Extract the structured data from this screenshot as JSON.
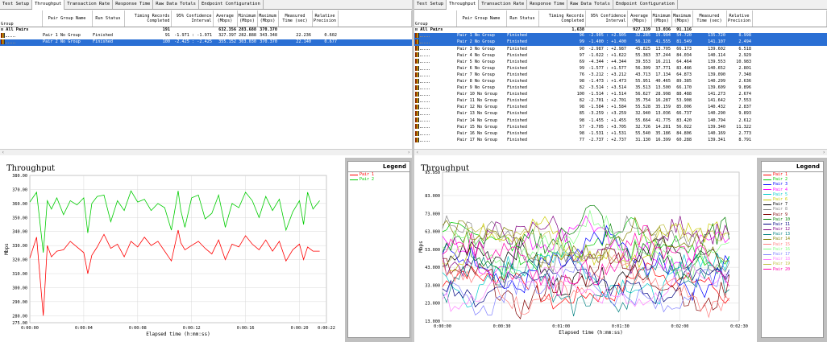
{
  "tabs": [
    "Test Setup",
    "Throughput",
    "Transaction Rate",
    "Response Time",
    "Raw Data Totals",
    "Endpoint Configuration"
  ],
  "columns": {
    "group": "Group",
    "pair_group_name": "Pair Group Name",
    "run_status": "Run Status",
    "timing_records": "Timing Records Completed",
    "confidence": "95% Confidence Interval",
    "average": "Average (Mbps)",
    "minimum": "Minimum (Mbps)",
    "maximum": "Maximum (Mbps)",
    "measured_time": "Measured Time (sec)",
    "precision": "Relative Precision"
  },
  "left": {
    "summary": {
      "label": "All Pairs",
      "records": "191",
      "average": "632.356",
      "minimum": "283.688",
      "maximum": "370.370",
      "measured": "",
      "precision": ""
    },
    "rows": [
      {
        "name": "Pair 1 No Group",
        "status": "Finished",
        "records": "91",
        "ci": "-1.971 : -1.971",
        "avg": "327.397",
        "min": "282.888",
        "max": "343.348",
        "time": "22.236",
        "prec": "0.602",
        "selected": false
      },
      {
        "name": "Pair 2 No Group",
        "status": "Finished",
        "records": "100",
        "ci": "-2.425 : -2.425",
        "avg": "355.152",
        "min": "303.030",
        "max": "370.370",
        "time": "22.140",
        "prec": "0.677",
        "selected": true
      }
    ],
    "chart": {
      "title": "Throughput",
      "legend_title": "Legend",
      "xlabel": "Elapsed time (h:mm:ss)",
      "ylabel": "Mbps"
    }
  },
  "right": {
    "summary": {
      "label": "All Pairs",
      "records": "1,638",
      "average": "927.139",
      "minimum": "13.036",
      "maximum": "91.116",
      "measured": "",
      "precision": ""
    },
    "rows": [
      {
        "name": "Pair 1 No Group",
        "status": "Finished",
        "records": "96",
        "ci": "-2.905 : +2.905",
        "avg": "32.285",
        "min": "15.994",
        "max": "54.720",
        "time": "135.720",
        "prec": "8.998",
        "selected": true
      },
      {
        "name": "Pair 2 No Group",
        "status": "Finished",
        "records": "99",
        "ci": "-1.400 : +1.400",
        "avg": "56.128",
        "min": "41.555",
        "max": "81.549",
        "time": "141.107",
        "prec": "2.494",
        "selected": true
      },
      {
        "name": "Pair 3 No Group",
        "status": "Finished",
        "records": "90",
        "ci": "-2.987 : +2.987",
        "avg": "45.825",
        "min": "13.705",
        "max": "66.173",
        "time": "139.602",
        "prec": "6.518",
        "selected": false
      },
      {
        "name": "Pair 4 No Group",
        "status": "Finished",
        "records": "97",
        "ci": "-1.622 : +1.622",
        "avg": "55.383",
        "min": "37.244",
        "max": "84.034",
        "time": "140.114",
        "prec": "2.929",
        "selected": false
      },
      {
        "name": "Pair 5 No Group",
        "status": "Finished",
        "records": "69",
        "ci": "-4.344 : +4.344",
        "avg": "39.553",
        "min": "16.211",
        "max": "64.464",
        "time": "139.553",
        "prec": "10.983",
        "selected": false
      },
      {
        "name": "Pair 6 No Group",
        "status": "Finished",
        "records": "99",
        "ci": "-1.577 : +1.577",
        "avg": "56.309",
        "min": "37.771",
        "max": "83.486",
        "time": "140.652",
        "prec": "2.801",
        "selected": false
      },
      {
        "name": "Pair 7 No Group",
        "status": "Finished",
        "records": "76",
        "ci": "-3.212 : +3.212",
        "avg": "43.713",
        "min": "17.134",
        "max": "64.873",
        "time": "139.090",
        "prec": "7.348",
        "selected": false
      },
      {
        "name": "Pair 8 No Group",
        "status": "Finished",
        "records": "98",
        "ci": "-1.473 : +1.473",
        "avg": "55.951",
        "min": "40.465",
        "max": "89.385",
        "time": "140.299",
        "prec": "2.636",
        "selected": false
      },
      {
        "name": "Pair 9 No Group",
        "status": "Finished",
        "records": "82",
        "ci": "-3.514 : +3.514",
        "avg": "35.513",
        "min": "13.500",
        "max": "66.170",
        "time": "139.609",
        "prec": "9.896",
        "selected": false
      },
      {
        "name": "Pair 10 No Group",
        "status": "Finished",
        "records": "100",
        "ci": "-1.514 : +1.514",
        "avg": "56.627",
        "min": "28.998",
        "max": "88.488",
        "time": "141.273",
        "prec": "2.674",
        "selected": false
      },
      {
        "name": "Pair 11 No Group",
        "status": "Finished",
        "records": "82",
        "ci": "-2.701 : +2.701",
        "avg": "35.754",
        "min": "16.287",
        "max": "53.908",
        "time": "141.642",
        "prec": "7.553",
        "selected": false
      },
      {
        "name": "Pair 12 No Group",
        "status": "Finished",
        "records": "98",
        "ci": "-1.584 : +1.584",
        "avg": "55.528",
        "min": "35.159",
        "max": "85.006",
        "time": "140.432",
        "prec": "2.837",
        "selected": false
      },
      {
        "name": "Pair 13 No Group",
        "status": "Finished",
        "records": "85",
        "ci": "-3.259 : +3.259",
        "avg": "32.940",
        "min": "13.036",
        "max": "66.737",
        "time": "140.290",
        "prec": "9.893",
        "selected": false
      },
      {
        "name": "Pair 14 No Group",
        "status": "Finished",
        "records": "98",
        "ci": "-1.455 : +1.455",
        "avg": "55.664",
        "min": "41.775",
        "max": "83.420",
        "time": "140.794",
        "prec": "2.612",
        "selected": false
      },
      {
        "name": "Pair 15 No Group",
        "status": "Finished",
        "records": "57",
        "ci": "-3.705 : +3.705",
        "avg": "32.726",
        "min": "14.281",
        "max": "56.022",
        "time": "139.340",
        "prec": "11.322",
        "selected": false
      },
      {
        "name": "Pair 16 No Group",
        "status": "Finished",
        "records": "98",
        "ci": "-1.531 : +1.531",
        "avg": "55.540",
        "min": "35.186",
        "max": "84.806",
        "time": "140.169",
        "prec": "2.773",
        "selected": false
      },
      {
        "name": "Pair 17 No Group",
        "status": "Finished",
        "records": "77",
        "ci": "-2.737 : +2.737",
        "avg": "31.130",
        "min": "16.399",
        "max": "60.288",
        "time": "139.341",
        "prec": "8.791",
        "selected": false
      }
    ],
    "chart": {
      "title": "Throughput",
      "legend_title": "Legend",
      "xlabel": "Elapsed time (h:mm:ss)",
      "ylabel": "Mbps"
    }
  },
  "chart_data": [
    {
      "type": "line",
      "title": "Throughput",
      "xlabel": "Elapsed time (h:mm:ss)",
      "ylabel": "Mbps",
      "ylim": [
        275,
        380
      ],
      "xlim": [
        0,
        22
      ],
      "yticks": [
        "380.00",
        "370.00",
        "360.00",
        "350.00",
        "340.00",
        "330.00",
        "320.00",
        "310.00",
        "300.00",
        "290.00",
        "280.00",
        "275.00"
      ],
      "xticks": [
        "0:00:00",
        "0:00:04",
        "0:00:08",
        "0:00:12",
        "0:00:16",
        "0:00:20",
        "0:00:22"
      ],
      "xtick_values": [
        0,
        4,
        8,
        12,
        16,
        20,
        22
      ],
      "series": [
        {
          "name": "Pair 1",
          "color": "#ff0000",
          "x": [
            0,
            0.5,
            1,
            1.3,
            1.6,
            2,
            2.5,
            3,
            3.5,
            4,
            4.3,
            4.6,
            5,
            5.5,
            6,
            6.5,
            7,
            7.5,
            8,
            8.5,
            9,
            9.5,
            10,
            10.5,
            11,
            11.2,
            11.5,
            12,
            12.5,
            13,
            13.5,
            14,
            14.5,
            15,
            15.5,
            16,
            16.5,
            17,
            17.5,
            18,
            18.5,
            19,
            19.5,
            20,
            20.3,
            20.6,
            21,
            21.5
          ],
          "y": [
            321,
            336,
            280,
            330,
            322,
            326,
            327,
            333,
            329,
            325,
            310,
            323,
            329,
            338,
            328,
            331,
            322,
            333,
            329,
            336,
            330,
            333,
            326,
            319,
            341,
            332,
            327,
            330,
            333,
            328,
            324,
            334,
            320,
            331,
            329,
            337,
            331,
            327,
            334,
            326,
            333,
            319,
            327,
            331,
            320,
            329,
            326,
            326
          ]
        },
        {
          "name": "Pair 2",
          "color": "#00cc00",
          "x": [
            0,
            0.5,
            1,
            1.3,
            1.6,
            2,
            2.5,
            3,
            3.5,
            4,
            4.3,
            4.6,
            5,
            5.5,
            6,
            6.5,
            7,
            7.5,
            8,
            8.5,
            9,
            9.5,
            10,
            10.5,
            11,
            11.2,
            11.5,
            12,
            12.5,
            13,
            13.5,
            14,
            14.5,
            15,
            15.5,
            16,
            16.5,
            17,
            17.5,
            18,
            18.5,
            19,
            19.5,
            20,
            20.3,
            20.6,
            21,
            21.5
          ],
          "y": [
            361,
            368,
            325,
            362,
            356,
            364,
            352,
            362,
            359,
            364,
            339,
            360,
            365,
            366,
            347,
            362,
            355,
            369,
            361,
            363,
            355,
            360,
            357,
            341,
            369,
            355,
            343,
            364,
            366,
            349,
            353,
            366,
            343,
            360,
            357,
            368,
            362,
            350,
            365,
            355,
            363,
            341,
            354,
            362,
            345,
            368,
            356,
            362
          ]
        }
      ]
    },
    {
      "type": "line",
      "title": "Throughput",
      "xlabel": "Elapsed time (h:mm:ss)",
      "ylabel": "Mbps",
      "ylim": [
        13,
        96
      ],
      "xlim": [
        0,
        150
      ],
      "yticks": [
        "95.950",
        "83.000",
        "73.000",
        "63.000",
        "53.000",
        "43.000",
        "33.000",
        "23.000",
        "13.000"
      ],
      "ytick_values": [
        95.95,
        83,
        73,
        63,
        53,
        43,
        33,
        23,
        13
      ],
      "xticks": [
        "0:00:00",
        "0:00:30",
        "0:01:00",
        "0:01:30",
        "0:02:00",
        "0:02:30"
      ],
      "xtick_values": [
        0,
        30,
        60,
        90,
        120,
        150
      ],
      "series": [
        {
          "name": "Pair 1",
          "color": "#ff0000"
        },
        {
          "name": "Pair 2",
          "color": "#00cc00"
        },
        {
          "name": "Pair 3",
          "color": "#0000ff"
        },
        {
          "name": "Pair 4",
          "color": "#ff00ff"
        },
        {
          "name": "Pair 5",
          "color": "#00cccc"
        },
        {
          "name": "Pair 6",
          "color": "#cccc00"
        },
        {
          "name": "Pair 7",
          "color": "#000000"
        },
        {
          "name": "Pair 8",
          "color": "#808080"
        },
        {
          "name": "Pair 9",
          "color": "#800000"
        },
        {
          "name": "Pair 10",
          "color": "#008000"
        },
        {
          "name": "Pair 11",
          "color": "#000080"
        },
        {
          "name": "Pair 12",
          "color": "#800080"
        },
        {
          "name": "Pair 13",
          "color": "#008080"
        },
        {
          "name": "Pair 14",
          "color": "#808000"
        },
        {
          "name": "Pair 15",
          "color": "#ff8080"
        },
        {
          "name": "Pair 16",
          "color": "#80ff80"
        },
        {
          "name": "Pair 17",
          "color": "#8080ff"
        },
        {
          "name": "Pair 18",
          "color": "#ff80ff"
        },
        {
          "name": "Pair 19",
          "color": "#c0c040"
        },
        {
          "name": "Pair 20",
          "color": "#ff00aa"
        }
      ]
    }
  ]
}
